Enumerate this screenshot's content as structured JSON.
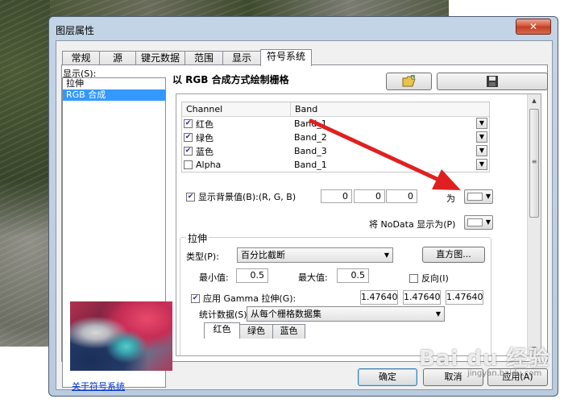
{
  "window": {
    "title": "图层属性",
    "close_icon": "✕"
  },
  "tabs": [
    {
      "label": "常规"
    },
    {
      "label": "源"
    },
    {
      "label": "键元数据"
    },
    {
      "label": "范围"
    },
    {
      "label": "显示"
    },
    {
      "label": "符号系统"
    }
  ],
  "show_panel": {
    "label": "显示(S):",
    "items": [
      {
        "label": "拉伸"
      },
      {
        "label": "RGB 合成"
      }
    ],
    "selected": "RGB 合成",
    "about_link": "关于符号系统"
  },
  "render": {
    "title": "以 RGB 合成方式绘制栅格",
    "open_icon": "folder-open-icon",
    "save_icon": "save-disk-icon"
  },
  "channel_table": {
    "headers": {
      "channel": "Channel",
      "band": "Band"
    },
    "rows": [
      {
        "channel": "红色",
        "band": "Band_1",
        "checked": true
      },
      {
        "channel": "绿色",
        "band": "Band_2",
        "checked": true
      },
      {
        "channel": "蓝色",
        "band": "Band_3",
        "checked": true
      },
      {
        "channel": "Alpha",
        "band": "Band_1",
        "checked": false
      }
    ]
  },
  "background": {
    "label": "显示背景值(B):(R, G, B)",
    "checked": true,
    "r": "0",
    "g": "0",
    "b": "0",
    "as_label": "为"
  },
  "nodata": {
    "label": "将 NoData 显示为(P)"
  },
  "stretch": {
    "group_label": "拉伸",
    "type_label": "类型(P):",
    "type_value": "百分比截断",
    "histogram_button": "直方图...",
    "min_label": "最小值:",
    "min_value": "0.5",
    "max_label": "最大值:",
    "max_value": "0.5",
    "invert_label": "反向(I)",
    "invert_checked": false,
    "gamma_label": "应用 Gamma 拉伸(G):",
    "gamma_checked": true,
    "gamma_values": [
      "1.47640",
      "1.47640",
      "1.47640"
    ],
    "stats_label": "统计数据(S)",
    "stats_value": "从每个栅格数据集",
    "inner_tabs": [
      "红色",
      "绿色",
      "蓝色"
    ]
  },
  "buttons": {
    "ok": "确定",
    "cancel": "取消",
    "apply": "应用(A)"
  },
  "watermark": {
    "brand": "Bai du 经验",
    "sub": "jingyan.baidu.com"
  },
  "colors": {
    "accent": "#3399ff",
    "arrow": "#e02020",
    "link": "#0033cc"
  }
}
